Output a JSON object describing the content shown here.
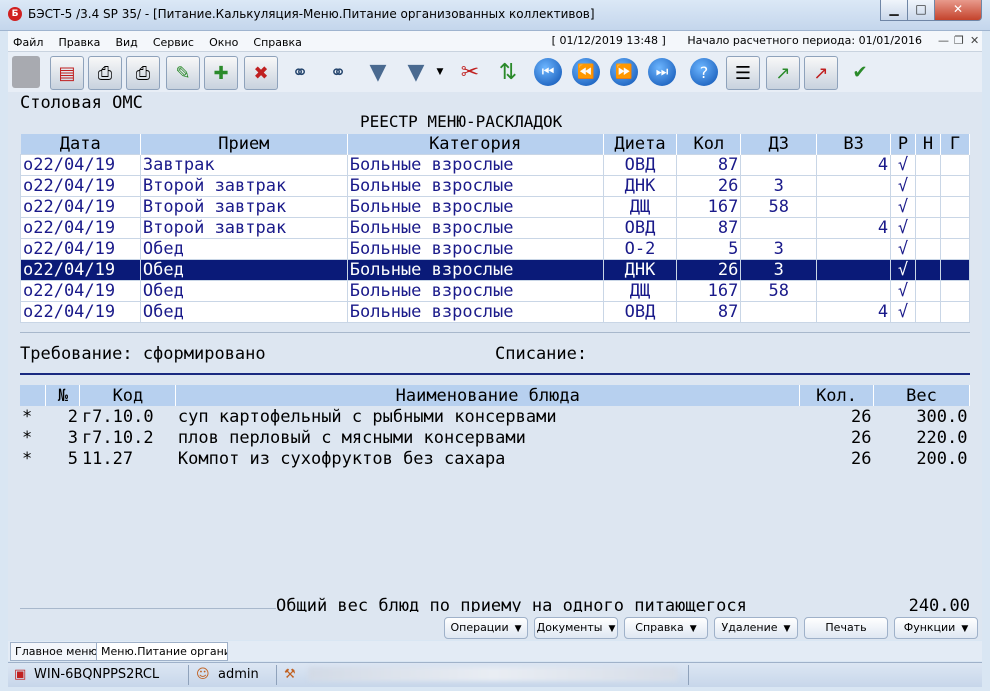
{
  "window": {
    "title": "БЭСТ-5 /3.4 SP 35/ - [Питание.Калькуляция-Меню.Питание организованных коллективов]",
    "app_icon": "Б"
  },
  "menu": {
    "items": [
      "Файл",
      "Правка",
      "Вид",
      "Сервис",
      "Окно",
      "Справка"
    ],
    "date": "[ 01/12/2019 13:48 ]",
    "period": "Начало расчетного периода: 01/01/2016"
  },
  "toolbar": {
    "icons": [
      "gray-block-icon",
      "document-icon",
      "printer-icon",
      "print-preview-icon",
      "edit-doc-icon",
      "add-row-icon",
      "delete-row-icon",
      "binoculars-icon",
      "binoculars-next-icon",
      "filter-icon",
      "filter-dropdown-icon",
      "clear-filter-icon",
      "sort-icon",
      "first-record-icon",
      "prev-record-icon",
      "next-record-icon",
      "last-record-icon",
      "help-icon",
      "report-icon",
      "chart-icon",
      "chart-edit-icon",
      "check-doc-icon"
    ]
  },
  "org_name": "Столовая ОМС",
  "register_title": "РЕЕСТР МЕНЮ-РАСКЛАДОК",
  "register": {
    "columns": [
      "Дата",
      "Прием",
      "Категория",
      "Диета",
      "Кол",
      "ДЗ",
      "ВЗ",
      "Р",
      "Н",
      "Г"
    ],
    "rows": [
      [
        "о22/04/19",
        "Завтрак",
        "Больные взрослые",
        "ОВД",
        "87",
        "",
        "4",
        "√",
        "",
        ""
      ],
      [
        "о22/04/19",
        "Второй завтрак",
        "Больные взрослые",
        "ДНК",
        "26",
        "3",
        "",
        "√",
        "",
        ""
      ],
      [
        "о22/04/19",
        "Второй завтрак",
        "Больные взрослые",
        "ДЩ",
        "167",
        "58",
        "",
        "√",
        "",
        ""
      ],
      [
        "о22/04/19",
        "Второй завтрак",
        "Больные взрослые",
        "ОВД",
        "87",
        "",
        "4",
        "√",
        "",
        ""
      ],
      [
        "о22/04/19",
        "Обед",
        "Больные взрослые",
        "О-2",
        "5",
        "3",
        "",
        "√",
        "",
        ""
      ],
      [
        "о22/04/19",
        "Обед",
        "Больные взрослые",
        "ДНК",
        "26",
        "3",
        "",
        "√",
        "",
        ""
      ],
      [
        "о22/04/19",
        "Обед",
        "Больные взрослые",
        "ДЩ",
        "167",
        "58",
        "",
        "√",
        "",
        ""
      ],
      [
        "о22/04/19",
        "Обед",
        "Больные взрослые",
        "ОВД",
        "87",
        "",
        "4",
        "√",
        "",
        ""
      ]
    ],
    "selected_index": 5
  },
  "requirement": "Требование: сформировано",
  "writeoff": "Списание:",
  "dishes": {
    "columns": [
      "",
      "№",
      "Код",
      "Наименование блюда",
      "Кол.",
      "Вес"
    ],
    "rows": [
      [
        "*",
        "2",
        "г7.10.0",
        "суп картофельный с рыбными консервами",
        "26",
        "300.0"
      ],
      [
        "*",
        "3",
        "г7.10.2",
        "плов перловый с мясными консервами",
        "26",
        "220.0"
      ],
      [
        "*",
        "5",
        "11.27",
        "Компот из сухофруктов без сахара",
        "26",
        "200.0"
      ]
    ]
  },
  "total": {
    "label": "Общий вес блюд по приему на одного питающегося",
    "value": "240.00"
  },
  "buttons": {
    "operations": "Операции",
    "documents": "Документы",
    "help": "Справка",
    "delete": "Удаление",
    "print": "Печать",
    "functions": "Функции"
  },
  "window_tabs": [
    "Главное меню",
    "Меню.Питание организ"
  ],
  "status": {
    "host": "WIN-6BQNPPS2RCL",
    "user": "admin"
  }
}
